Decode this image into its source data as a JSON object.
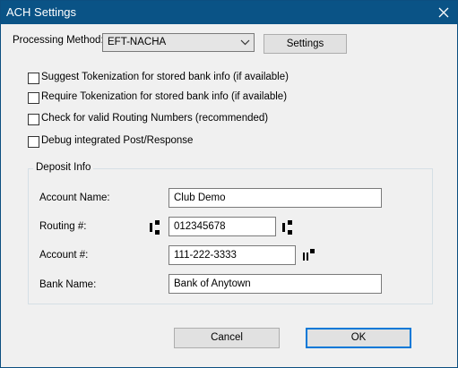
{
  "window": {
    "title": "ACH Settings"
  },
  "processing": {
    "label": "Processing Method:",
    "selected": "EFT-NACHA",
    "settings_label": "Settings"
  },
  "checkboxes": [
    {
      "label": "Suggest Tokenization for stored bank info (if available)",
      "checked": false
    },
    {
      "label": "Require Tokenization for stored bank info (if available)",
      "checked": false
    },
    {
      "label": "Check for valid Routing Numbers (recommended)",
      "checked": false
    },
    {
      "label": "Debug integrated Post/Response",
      "checked": false
    }
  ],
  "deposit": {
    "title": "Deposit Info",
    "account_name_label": "Account Name:",
    "account_name_value": "Club Demo",
    "routing_label": "Routing #:",
    "routing_value": "012345678",
    "account_label": "Account #:",
    "account_value": "111-222-3333",
    "bank_name_label": "Bank Name:",
    "bank_name_value": "Bank of Anytown"
  },
  "buttons": {
    "cancel": "Cancel",
    "ok": "OK"
  },
  "icons": {
    "routing_left": "micr-transit-symbol-icon",
    "routing_right": "micr-transit-symbol-icon",
    "account_right": "micr-on-us-symbol-icon"
  }
}
